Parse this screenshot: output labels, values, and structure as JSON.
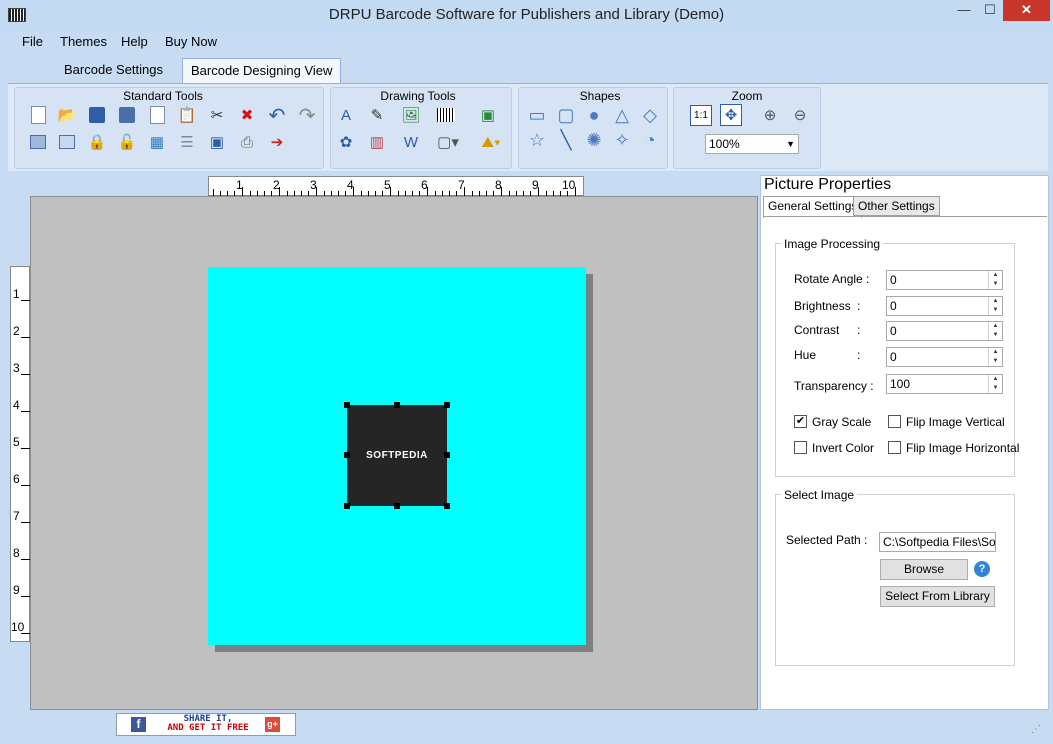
{
  "window": {
    "title": "DRPU Barcode Software for Publishers and Library (Demo)",
    "minimize": "—",
    "maximize": "☐",
    "close": "✕"
  },
  "menu": [
    "File",
    "Themes",
    "Help",
    "Buy Now"
  ],
  "tabs": [
    "Barcode Settings",
    "Barcode Designing View"
  ],
  "ribbon": {
    "groups": [
      "Standard Tools",
      "Drawing Tools",
      "Shapes",
      "Zoom"
    ],
    "zoom_label": "1:1",
    "zoom_value": "100%"
  },
  "ruler": {
    "h_numbers": [
      "1",
      "2",
      "3",
      "4",
      "5",
      "6",
      "7",
      "8",
      "9",
      "10"
    ],
    "v_numbers": [
      "1",
      "2",
      "3",
      "4",
      "5",
      "6",
      "7",
      "8",
      "9",
      "10"
    ]
  },
  "canvas": {
    "page_color": "#00ffff",
    "image_text": "SOFTPEDIA"
  },
  "properties": {
    "title": "Picture Properties",
    "tabs": [
      "General Settings",
      "Other Settings"
    ],
    "image_processing": {
      "legend": "Image Processing",
      "rotate_label": "Rotate Angle :",
      "rotate_value": "0",
      "brightness_label": "Brightness",
      "brightness_value": "0",
      "contrast_label": "Contrast",
      "contrast_value": "0",
      "hue_label": "Hue",
      "hue_value": "0",
      "transparency_label": "Transparency :",
      "transparency_value": "100",
      "colon": ":",
      "gray_scale": "Gray Scale",
      "gray_scale_checked": true,
      "invert_color": "Invert Color",
      "invert_color_checked": false,
      "flip_vertical": "Flip Image Vertical",
      "flip_vertical_checked": false,
      "flip_horizontal": "Flip Image Horizontal",
      "flip_horizontal_checked": false,
      "check_mark": "✔"
    },
    "select_image": {
      "legend": "Select Image",
      "path_label": "Selected Path :",
      "path_value": "C:\\Softpedia Files\\Softp",
      "browse": "Browse",
      "help": "?",
      "library": "Select From Library"
    }
  },
  "statusbar": {
    "share_line1": "SHARE IT,",
    "share_line2": "AND GET IT FREE",
    "facebook": "f",
    "gplus": "g+"
  }
}
